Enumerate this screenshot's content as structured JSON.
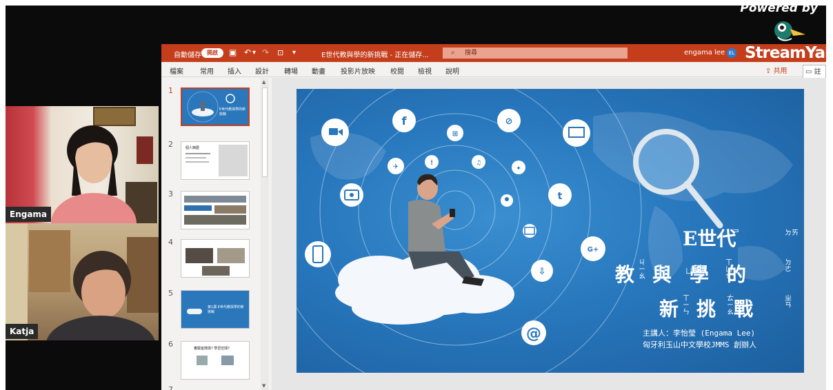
{
  "branding": {
    "powered_by": "Powered by",
    "logo_text": "StreamYard"
  },
  "participants": [
    {
      "name": "Engama"
    },
    {
      "name": "Katja"
    }
  ],
  "titlebar": {
    "autosave": "自動儲存",
    "autosave_state": "開啟",
    "file_title": "E世代教與學的新挑戰 - 正在儲存...",
    "search_placeholder": "搜尋",
    "user_name": "engama lee",
    "user_initials": "EL"
  },
  "ribbon": {
    "tabs": [
      "檔案",
      "常用",
      "插入",
      "設計",
      "轉場",
      "動畫",
      "投影片放映",
      "校閱",
      "檢視",
      "說明"
    ],
    "share": "共用",
    "comment": "註解"
  },
  "thumbnails": [
    {
      "num": "1",
      "title": "E世代教與學的新挑戰"
    },
    {
      "num": "2",
      "title": "個人簡歷"
    },
    {
      "num": "3",
      "title": ""
    },
    {
      "num": "4",
      "title": ""
    },
    {
      "num": "5",
      "title": "第1講 E世代教與學的新挑戰"
    },
    {
      "num": "6",
      "title": "實驗室環境? 學習空間?"
    },
    {
      "num": "7",
      "title": ""
    }
  ],
  "slide": {
    "title_line1": "E世代",
    "title_line2": "教與學的",
    "title_line3": "新挑戰",
    "bopo": {
      "shi": "ㄕ",
      "dai": "ㄉㄞ",
      "jiao": "ㄐㄧㄠ",
      "yu": "ㄩ",
      "xue": "ㄒㄩㄝ",
      "de": "ㄉㄜ",
      "xin": "ㄒㄧㄣ",
      "tiao": "ㄊㄧㄠ",
      "zhan": "ㄓㄢ"
    },
    "presenter": "主講人：李怡瑩 (Engama Lee)",
    "school": "匈牙利玉山中文學校JMMS 創辦人"
  },
  "colors": {
    "ppt_accent": "#c43e1c",
    "slide_blue": "#2877bd"
  }
}
